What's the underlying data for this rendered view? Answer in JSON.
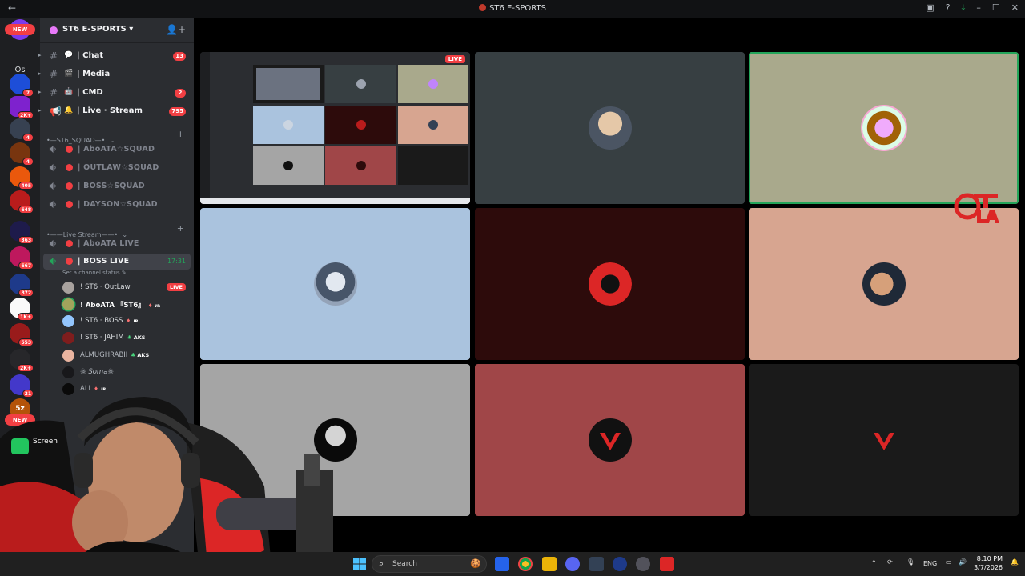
{
  "window": {
    "title": "ST6 E-SPORTS"
  },
  "rail": {
    "new_label_top": "NEW",
    "os_label": "Os",
    "new_label_bottom": "NEW",
    "badges": [
      "7",
      "2K+",
      "4",
      "4",
      "405",
      "648",
      "363",
      "667",
      "872",
      "1K+",
      "553",
      "2K+",
      "21"
    ],
    "bottom_label": "5z"
  },
  "server": {
    "name": "ST6 E-SPORTS"
  },
  "channels": [
    {
      "icon": "speech-balloon",
      "label": "| Chat",
      "count": "13"
    },
    {
      "icon": "clapper-board",
      "label": "| Media",
      "count": ""
    },
    {
      "icon": "robot",
      "label": "| CMD",
      "count": "2"
    },
    {
      "icon": "bell",
      "label": "| Live · Stream",
      "count": "795"
    }
  ],
  "categories": {
    "squad": "•—ST6_SQUAD—•",
    "live": "•——Live Stream——•"
  },
  "squad_channels": [
    "| AboATA☆SQUAD",
    "| OUTLAW☆SQUAD",
    "| BOSS☆SQUAD",
    "| DAYSON☆SQUAD"
  ],
  "live_channels": [
    {
      "label": "| AboATA LIVE",
      "time": ""
    },
    {
      "label": "| BOSS LIVE",
      "time": "17:31"
    }
  ],
  "channel_status": "Set a channel status ✎",
  "members": [
    {
      "name": "! ST6 · OutLaw",
      "live": "LIVE",
      "tag": ""
    },
    {
      "name": "! AboATA 『ST6』",
      "live": "",
      "tag": "ᴊʀ"
    },
    {
      "name": "! ST6 · BOSS",
      "live": "",
      "tag": "ᴊʀ"
    },
    {
      "name": "! ST6 · JAHIM",
      "live": "",
      "tag": "AKS"
    },
    {
      "name": "ALMUGHRABII",
      "live": "",
      "tag": "AKS"
    },
    {
      "name": "☠ Soma☠",
      "live": "",
      "tag": ""
    },
    {
      "name": "ALI",
      "live": "",
      "tag": "ᴊʀ"
    }
  ],
  "stream": {
    "live_badge": "LIVE",
    "tile_colors": [
      "#373f42",
      "#a9a98c",
      "#aac3de",
      "#2d0b0b",
      "#d7a590",
      "#a5a5a5",
      "#a04648",
      "#1a1a1a"
    ]
  },
  "overlay": {
    "screenrec_label": "Screen"
  },
  "taskbar": {
    "search_placeholder": "Search",
    "lang": "ENG",
    "time": "8:10 PM",
    "date": "3/7/2026"
  }
}
